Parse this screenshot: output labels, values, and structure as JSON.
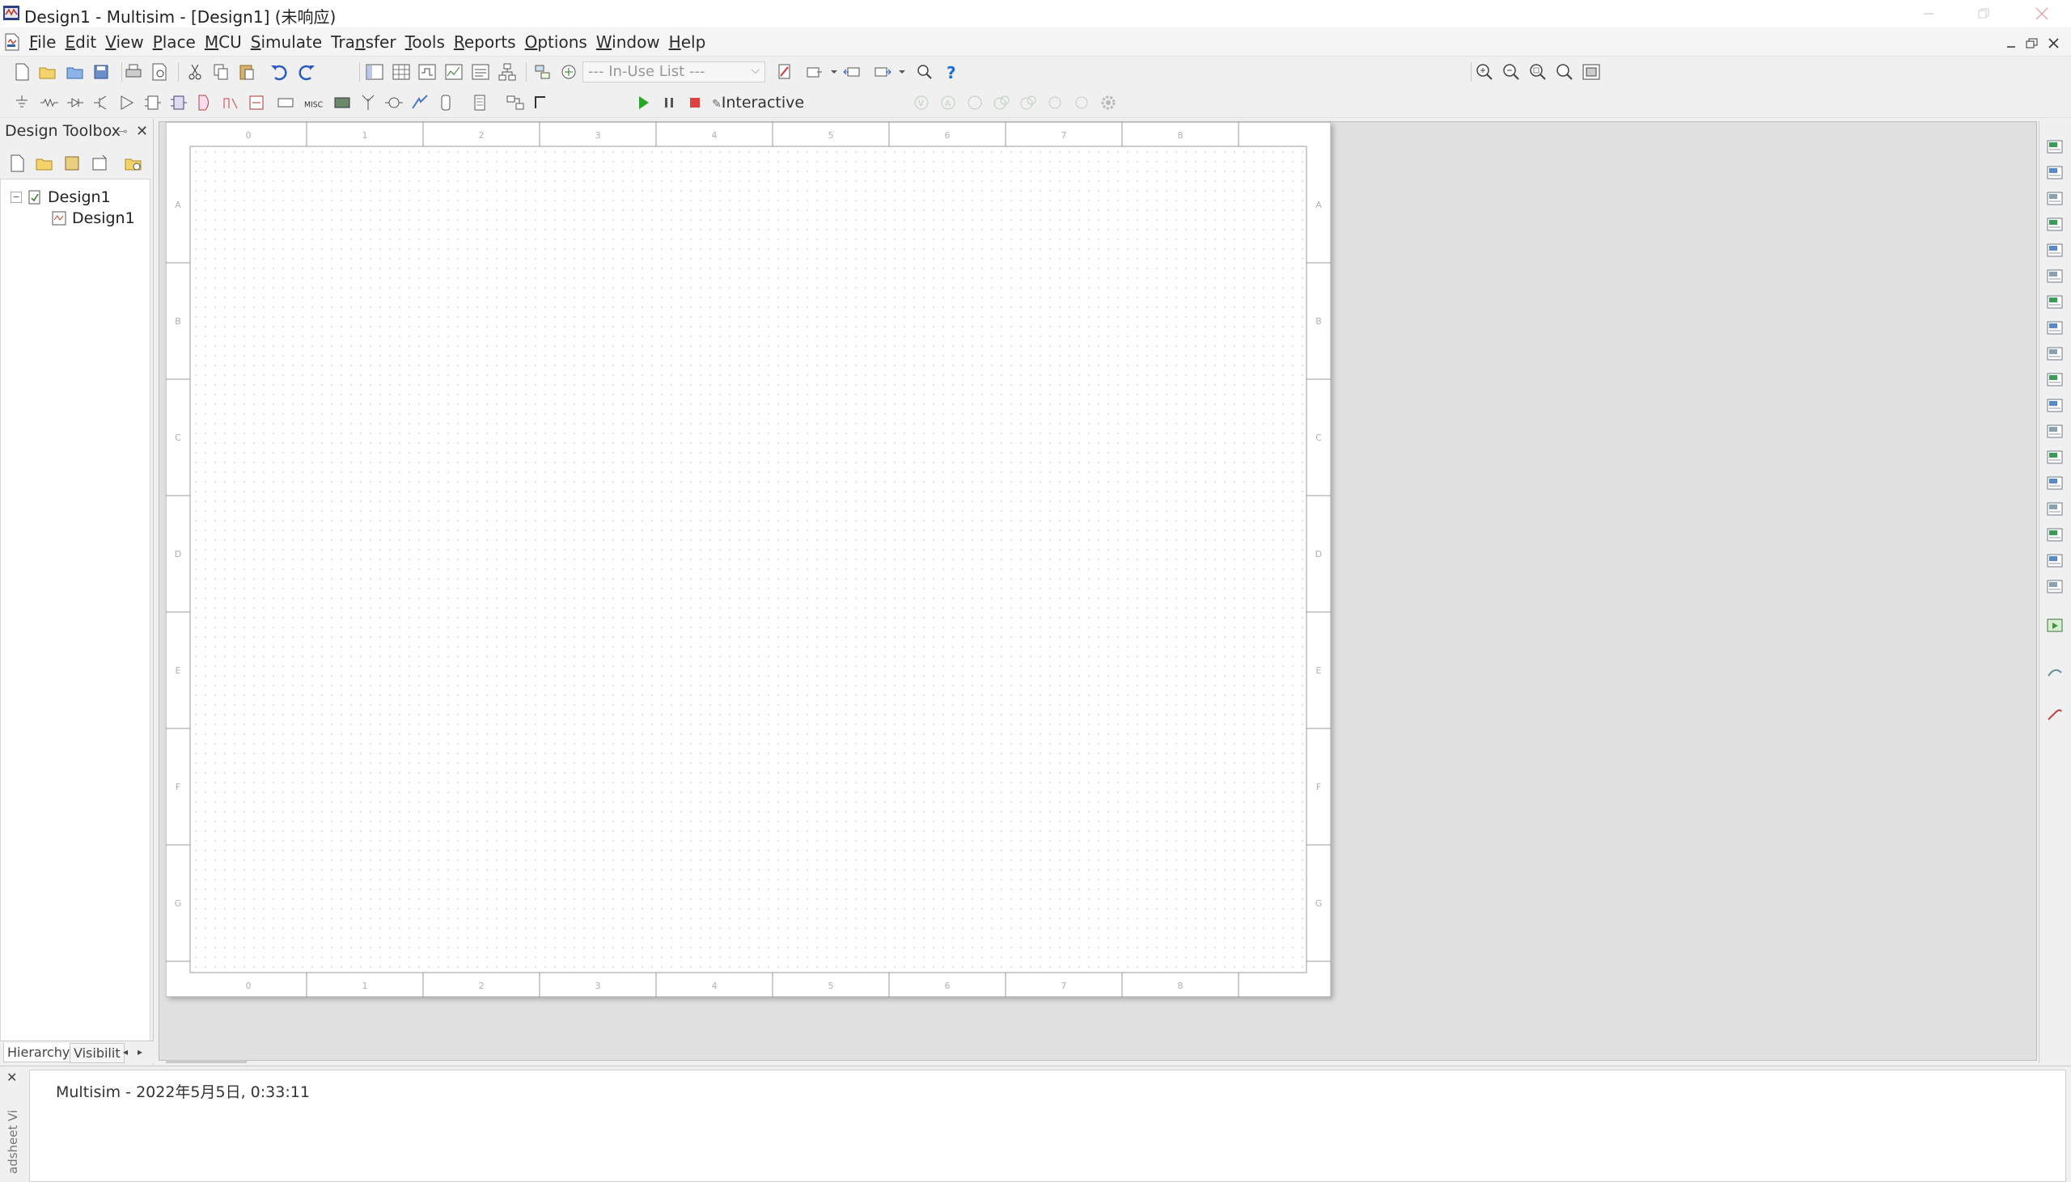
{
  "window": {
    "title": "Design1 - Multisim - [Design1] (未响应)"
  },
  "menu": [
    {
      "pre": "",
      "acc": "F",
      "post": "ile"
    },
    {
      "pre": "",
      "acc": "E",
      "post": "dit"
    },
    {
      "pre": "",
      "acc": "V",
      "post": "iew"
    },
    {
      "pre": "",
      "acc": "P",
      "post": "lace"
    },
    {
      "pre": "",
      "acc": "M",
      "post": "CU"
    },
    {
      "pre": "",
      "acc": "S",
      "post": "imulate"
    },
    {
      "pre": "Tra",
      "acc": "n",
      "post": "sfer"
    },
    {
      "pre": "",
      "acc": "T",
      "post": "ools"
    },
    {
      "pre": "",
      "acc": "R",
      "post": "eports"
    },
    {
      "pre": "",
      "acc": "O",
      "post": "ptions"
    },
    {
      "pre": "",
      "acc": "W",
      "post": "indow"
    },
    {
      "pre": "",
      "acc": "H",
      "post": "elp"
    }
  ],
  "toolbar": {
    "in_use_list": "--- In-Use List ---",
    "interactive": "Interactive",
    "misc_label": "MISC"
  },
  "toolbox": {
    "title": "Design Toolbox",
    "tree_root": "Design1",
    "tree_child": "Design1",
    "tabs": {
      "hierarchy": "Hierarchy",
      "visibility": "Visibilit"
    }
  },
  "sheet": {
    "column_labels": [
      "0",
      "1",
      "2",
      "3",
      "4",
      "5",
      "6",
      "7",
      "8"
    ],
    "row_labels": [
      "A",
      "B",
      "C",
      "D",
      "E",
      "F",
      "G"
    ]
  },
  "output": {
    "side_label": "adsheet Vi",
    "line": "Multisim  -  2022年5月5日, 0:33:11"
  }
}
